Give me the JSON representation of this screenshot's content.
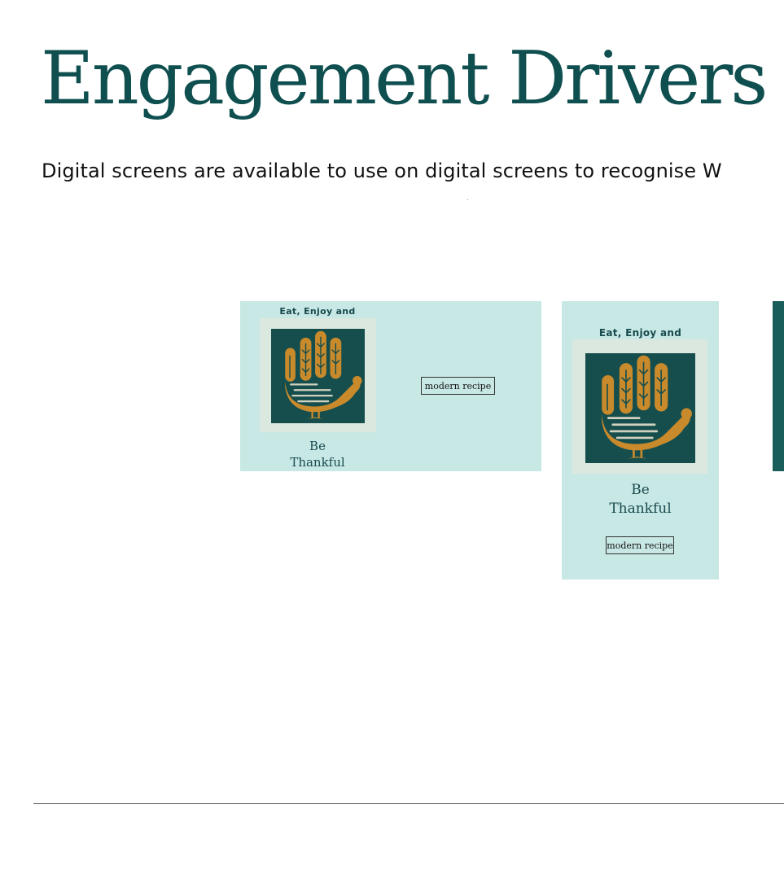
{
  "header": {
    "title": "Engagement Drivers",
    "subtitle": "Digital screens are available to use on digital screens to recognise W"
  },
  "cards": {
    "wide": {
      "eyebrow": "Eat, Enjoy and",
      "headline": "Be\nThankful",
      "button_label": "modern recipe"
    },
    "tall": {
      "eyebrow": "Eat, Enjoy and",
      "headline": "Be\nThankful",
      "button_label": "modern recipe"
    }
  },
  "colors": {
    "title": "#0f4f50",
    "card_bg": "#c8e8e5",
    "art_bg": "#154e4d",
    "turkey": "#c98a2c",
    "dark_card": "#195e5a"
  }
}
